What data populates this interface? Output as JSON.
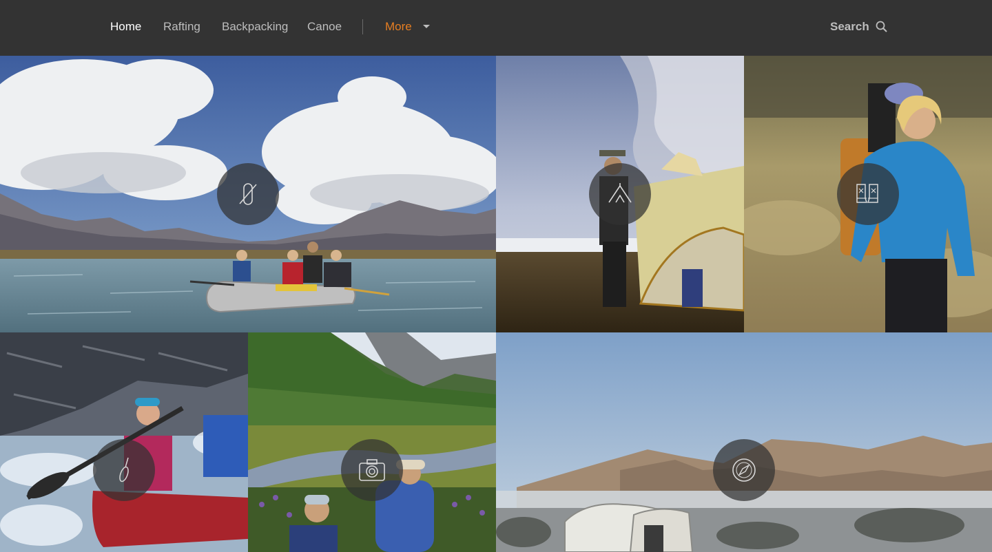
{
  "nav": {
    "items": [
      {
        "label": "Home",
        "active": true
      },
      {
        "label": "Rafting",
        "active": false
      },
      {
        "label": "Backpacking",
        "active": false
      },
      {
        "label": "Canoe",
        "active": false
      }
    ],
    "more_label": "More",
    "search_label": "Search",
    "accent_color": "#e67e22"
  },
  "tiles": [
    {
      "category": "rafting",
      "icon": "carabiner-icon",
      "scene": "river raft under mountains and clouds"
    },
    {
      "category": "camping",
      "icon": "tent-icon",
      "scene": "person pitching tent"
    },
    {
      "category": "backpacking",
      "icon": "boots-icon",
      "scene": "hiker with backpack in grass"
    },
    {
      "category": "canoe",
      "icon": "paddle-icon",
      "scene": "canoe in whitewater"
    },
    {
      "category": "photography",
      "icon": "camera-icon",
      "scene": "people photographing valley"
    },
    {
      "category": "exploration",
      "icon": "compass-icon",
      "scene": "tents in foggy mountain meadow"
    }
  ]
}
